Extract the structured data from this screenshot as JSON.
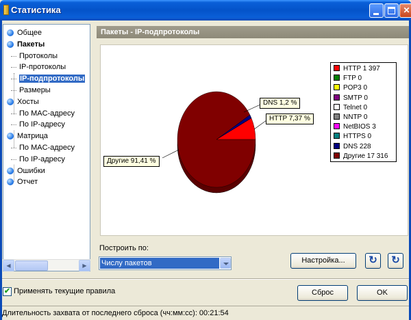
{
  "window": {
    "title": "Статистика"
  },
  "nav": {
    "items": [
      {
        "label": "Общее",
        "bold": false,
        "bullet": true,
        "indent": 0
      },
      {
        "label": "Пакеты",
        "bold": true,
        "bullet": true,
        "indent": 0
      },
      {
        "label": "Протоколы",
        "bold": false,
        "bullet": false,
        "indent": 1
      },
      {
        "label": "IP-протоколы",
        "bold": false,
        "bullet": false,
        "indent": 1
      },
      {
        "label": "IP-подпротоколы",
        "bold": true,
        "bullet": false,
        "indent": 1,
        "selected": true
      },
      {
        "label": "Размеры",
        "bold": false,
        "bullet": false,
        "indent": 1
      },
      {
        "label": "Хосты",
        "bold": false,
        "bullet": true,
        "indent": 0
      },
      {
        "label": "По MAC-адресу",
        "bold": false,
        "bullet": false,
        "indent": 1
      },
      {
        "label": "По IP-адресу",
        "bold": false,
        "bullet": false,
        "indent": 1
      },
      {
        "label": "Матрица",
        "bold": false,
        "bullet": true,
        "indent": 0
      },
      {
        "label": "По MAC-адресу",
        "bold": false,
        "bullet": false,
        "indent": 1
      },
      {
        "label": "По IP-адресу",
        "bold": false,
        "bullet": false,
        "indent": 1
      },
      {
        "label": "Ошибки",
        "bold": false,
        "bullet": true,
        "indent": 0
      },
      {
        "label": "Отчет",
        "bold": false,
        "bullet": true,
        "indent": 0
      }
    ]
  },
  "panel": {
    "header": "Пакеты - IP-подпротоколы"
  },
  "chart_data": {
    "type": "pie",
    "title": "",
    "style": "3d",
    "series": [
      {
        "name": "HTTP",
        "value": 1397,
        "color": "#ff0000"
      },
      {
        "name": "FTP",
        "value": 0,
        "color": "#008000"
      },
      {
        "name": "POP3",
        "value": 0,
        "color": "#ffff00"
      },
      {
        "name": "SMTP",
        "value": 0,
        "color": "#800080"
      },
      {
        "name": "Telnet",
        "value": 0,
        "color": "#ffffff"
      },
      {
        "name": "NNTP",
        "value": 0,
        "color": "#808080"
      },
      {
        "name": "NetBIOS",
        "value": 3,
        "color": "#ff00ff"
      },
      {
        "name": "HTTPS",
        "value": 0,
        "color": "#008080"
      },
      {
        "name": "DNS",
        "value": 228,
        "color": "#000080"
      },
      {
        "name": "Другие",
        "value": 17316,
        "color": "#800000"
      }
    ],
    "legend_entries": [
      "HTTP 1 397",
      "FTP 0",
      "POP3 0",
      "SMTP 0",
      "Telnet 0",
      "NNTP 0",
      "NetBIOS 3",
      "HTTPS 0",
      "DNS 228",
      "Другие 17 316"
    ],
    "callouts": {
      "dns": "DNS 1,2 %",
      "http": "HTTP 7,37 %",
      "other": "Другие 91,41 %"
    },
    "legend_position": "right"
  },
  "controls": {
    "build_by_label": "Построить по:",
    "build_by_value": "Числу пакетов",
    "settings_button": "Настройка...",
    "refresh_icon": "refresh-icon",
    "refresh2_icon": "refresh-icon",
    "apply_rules_label": "Применять текущие правила",
    "apply_rules_checked": true,
    "reset_button": "Сброс",
    "ok_button": "OK"
  },
  "status": {
    "text": "Длительность захвата от последнего сброса (чч:мм:сс): 00:21:54"
  }
}
